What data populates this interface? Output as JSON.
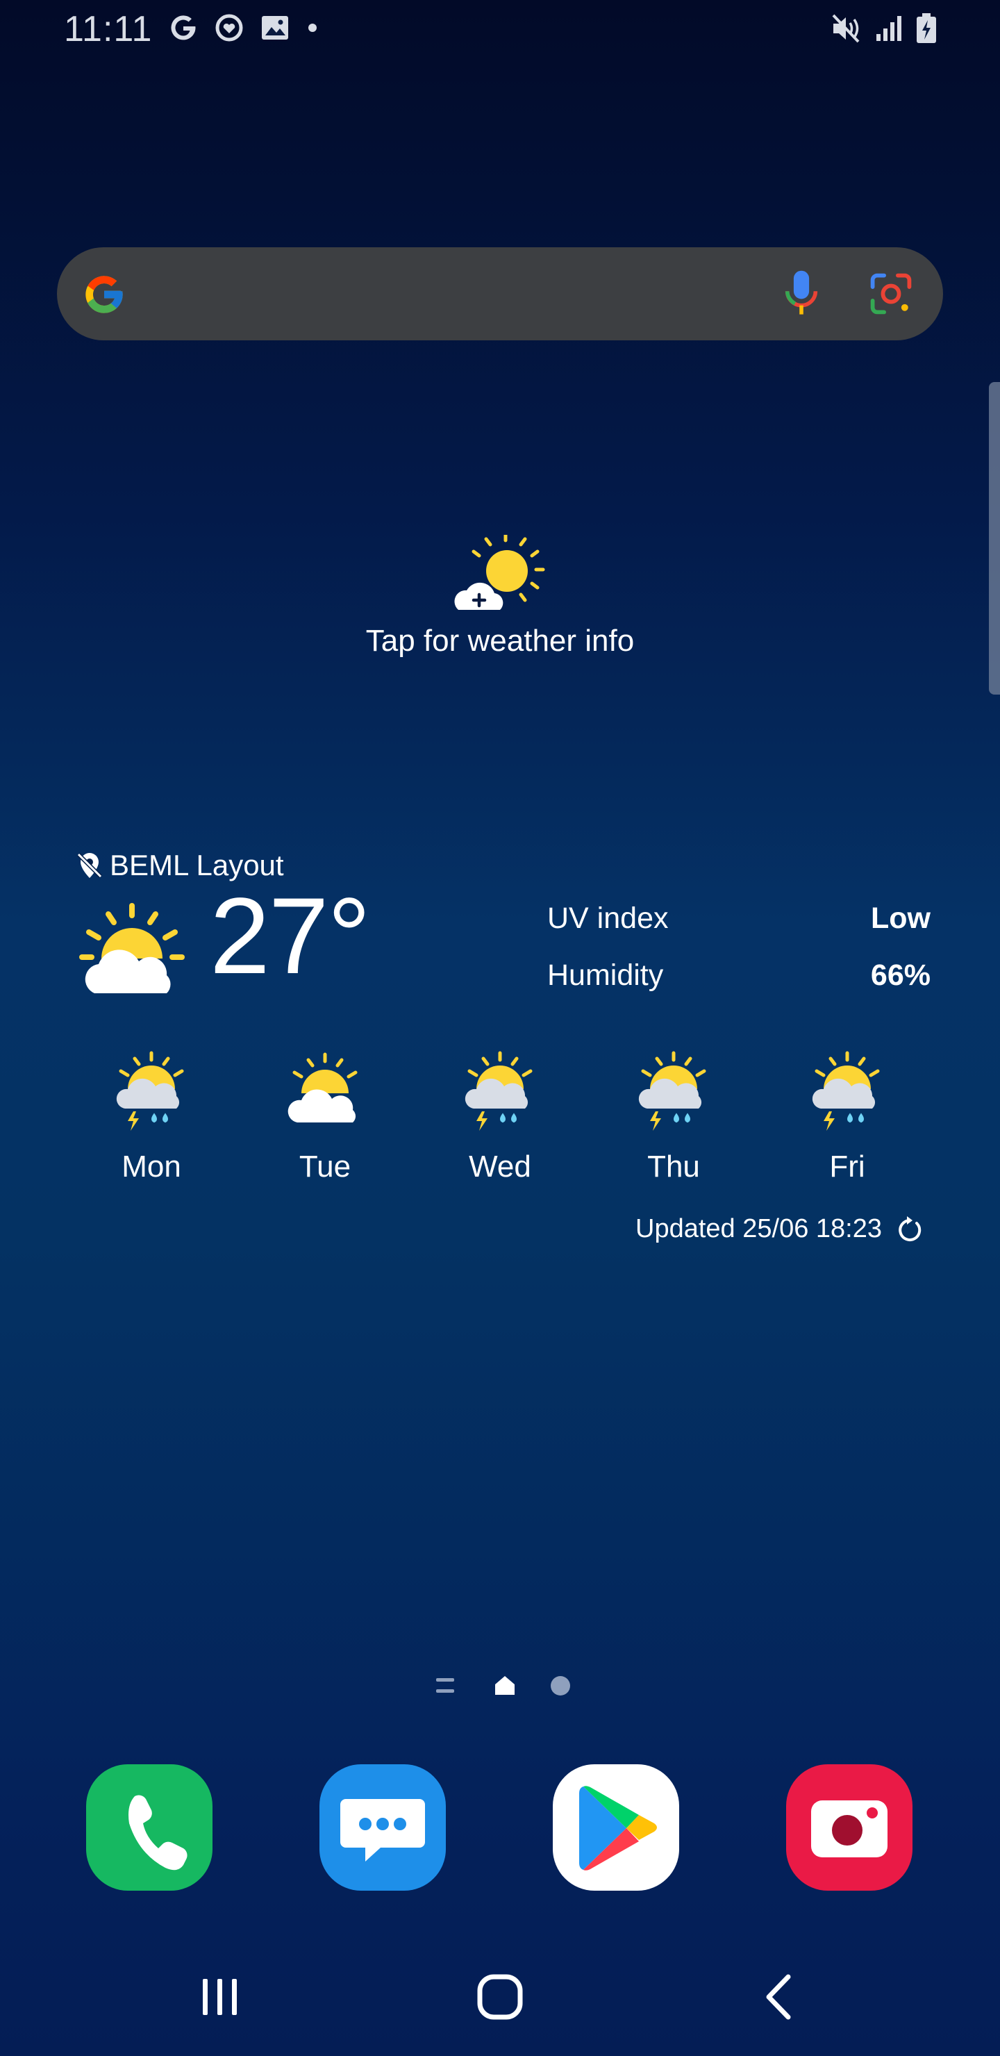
{
  "status_bar": {
    "time": "11:11",
    "left_icons": [
      "google-icon",
      "heart-monitor-icon",
      "gallery-icon",
      "dot-icon"
    ],
    "right_icons": [
      "mute-icon",
      "signal-icon",
      "battery-charging-icon"
    ]
  },
  "search": {
    "placeholder": "",
    "icons": [
      "google-logo-icon",
      "mic-icon",
      "lens-icon"
    ]
  },
  "weather_prompt": {
    "label": "Tap for weather info"
  },
  "weather": {
    "location": "BEML Layout",
    "temperature": "27°",
    "stats": [
      {
        "label": "UV index",
        "value": "Low"
      },
      {
        "label": "Humidity",
        "value": "66%"
      }
    ],
    "forecast": [
      {
        "day": "Mon",
        "icon": "thunder-rain-sun-icon"
      },
      {
        "day": "Tue",
        "icon": "partly-cloudy-icon"
      },
      {
        "day": "Wed",
        "icon": "thunder-rain-sun-icon"
      },
      {
        "day": "Thu",
        "icon": "thunder-rain-sun-icon"
      },
      {
        "day": "Fri",
        "icon": "thunder-rain-sun-icon"
      }
    ],
    "updated": "Updated 25/06 18:23"
  },
  "pager": {
    "pages": [
      "list",
      "home",
      "page"
    ]
  },
  "dock": {
    "apps": [
      "Phone",
      "Messages",
      "Play Store",
      "Camera"
    ]
  },
  "colors": {
    "sun": "#fcd535",
    "search_bg": "#3d3f42",
    "phone": "#16b861",
    "messages": "#1e8fe9",
    "camera": "#ea1a46"
  }
}
